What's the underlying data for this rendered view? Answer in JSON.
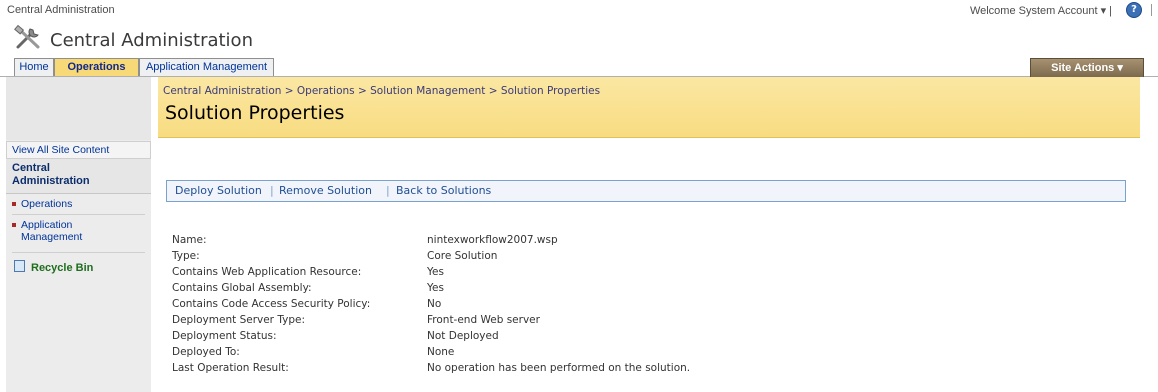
{
  "topbar": {
    "site_name": "Central Administration",
    "welcome": "Welcome System Account ▾ |",
    "help": "?"
  },
  "header": {
    "title": "Central Administration",
    "logo_icon": "tools-icon"
  },
  "tabs": [
    {
      "label": "Home",
      "active": false
    },
    {
      "label": "Operations",
      "active": true
    },
    {
      "label": "Application Management",
      "active": false
    }
  ],
  "site_actions": "Site Actions ▾",
  "leftnav": {
    "view_all": "View All Site Content",
    "heading": "Central Administration",
    "items": [
      {
        "label": "Operations"
      },
      {
        "label": "Application Management"
      }
    ],
    "recycle": "Recycle Bin"
  },
  "breadcrumb": {
    "items": [
      "Central Administration",
      "Operations",
      "Solution Management",
      "Solution Properties"
    ],
    "separator": ">"
  },
  "page_title": "Solution Properties",
  "toolbar": {
    "deploy": "Deploy Solution",
    "remove": "Remove Solution",
    "back": "Back to Solutions",
    "sep": "|"
  },
  "properties": [
    {
      "key": "Name:",
      "value": "nintexworkflow2007.wsp"
    },
    {
      "key": "Type:",
      "value": "Core Solution"
    },
    {
      "key": "Contains Web Application Resource:",
      "value": "Yes"
    },
    {
      "key": "Contains Global Assembly:",
      "value": "Yes"
    },
    {
      "key": "Contains Code Access Security Policy:",
      "value": "No"
    },
    {
      "key": "Deployment Server Type:",
      "value": "Front-end Web server"
    },
    {
      "key": "Deployment Status:",
      "value": "Not Deployed"
    },
    {
      "key": "Deployed To:",
      "value": "None"
    },
    {
      "key": "Last Operation Result:",
      "value": "No operation has been performed on the solution."
    }
  ],
  "colors": {
    "band": "#f8dc81",
    "active_tab": "#f7d977",
    "link": "#1f4e94",
    "site_actions": "#7d6a4d"
  }
}
